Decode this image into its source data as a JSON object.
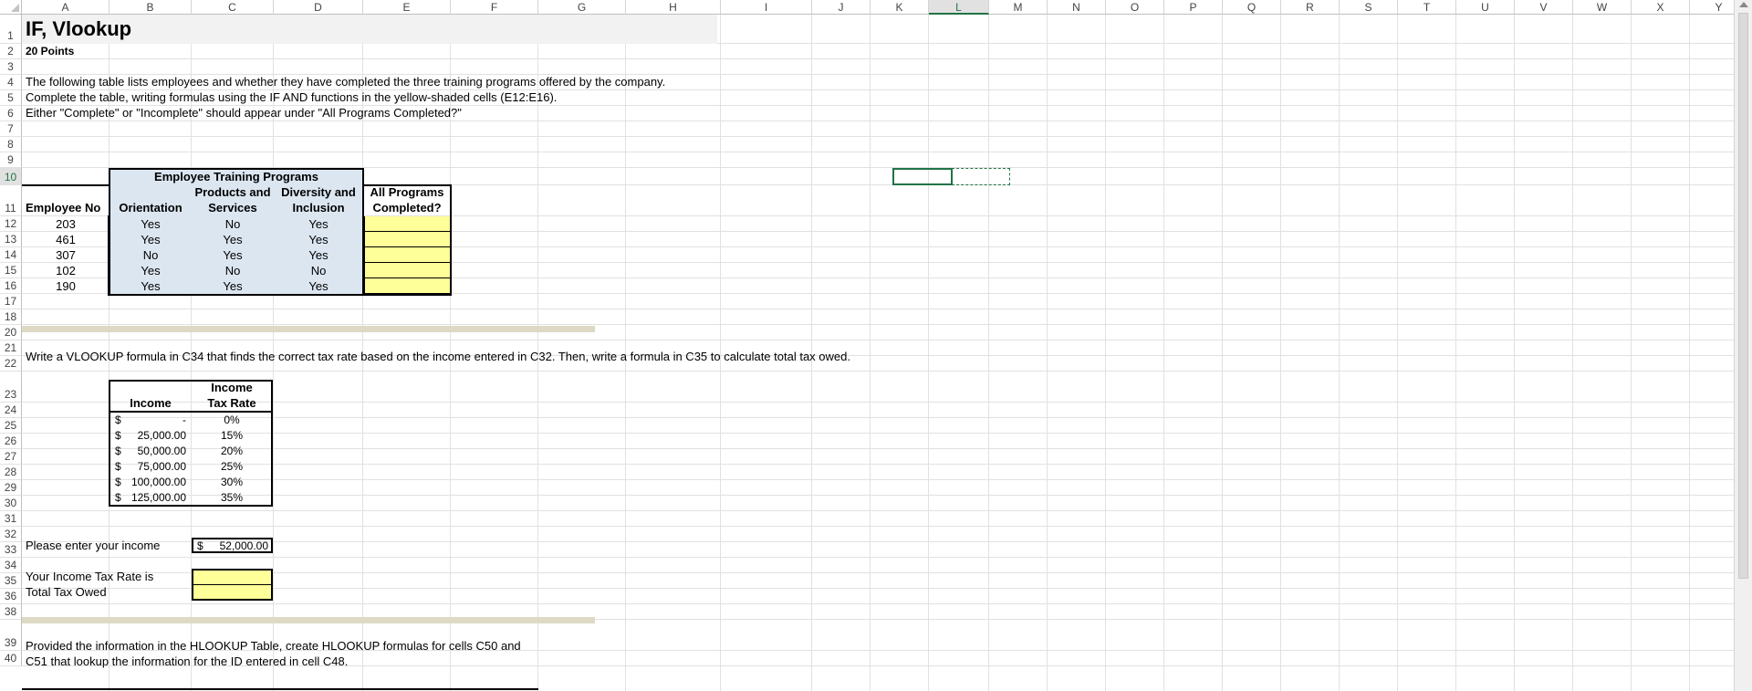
{
  "columns": [
    "A",
    "B",
    "C",
    "D",
    "E",
    "F",
    "G",
    "H",
    "I",
    "J",
    "K",
    "L",
    "M",
    "N",
    "O",
    "P",
    "Q",
    "R",
    "S",
    "T",
    "U",
    "V",
    "W",
    "X",
    "Y"
  ],
  "selected_column": "L",
  "rows": [
    {
      "n": "1"
    },
    {
      "n": "2"
    },
    {
      "n": "3"
    },
    {
      "n": "4"
    },
    {
      "n": "5"
    },
    {
      "n": "6"
    },
    {
      "n": "7"
    },
    {
      "n": "8"
    },
    {
      "n": "9"
    },
    {
      "n": "10"
    },
    {
      "n": "11"
    },
    {
      "n": "12"
    },
    {
      "n": "13"
    },
    {
      "n": "14"
    },
    {
      "n": "15"
    },
    {
      "n": "16"
    },
    {
      "n": "17"
    },
    {
      "n": "18"
    },
    {
      "n": "20"
    },
    {
      "n": "21"
    },
    {
      "n": "22"
    },
    {
      "n": "23"
    },
    {
      "n": "24"
    },
    {
      "n": "25"
    },
    {
      "n": "26"
    },
    {
      "n": "27"
    },
    {
      "n": "28"
    },
    {
      "n": "29"
    },
    {
      "n": "30"
    },
    {
      "n": "31"
    },
    {
      "n": "32"
    },
    {
      "n": "33"
    },
    {
      "n": "34"
    },
    {
      "n": "35"
    },
    {
      "n": "36"
    },
    {
      "n": "38"
    },
    {
      "n": "39"
    },
    {
      "n": "40"
    }
  ],
  "selected_row": "10",
  "title": "IF, Vlookup",
  "points": "20 Points",
  "instructions": [
    "The following table lists employees and whether they have completed the three training programs offered by the company.",
    "Complete the table, writing formulas using the IF AND functions in the yellow-shaded cells (E12:E16).",
    "Either \"Complete\" or \"Incomplete\" should appear under \"All Programs Completed?\""
  ],
  "training_table": {
    "group_header": "Employee Training Programs",
    "headers": {
      "employee_no": "Employee No",
      "orientation": "Orientation",
      "products_line1": "Products and",
      "products_line2": "Services",
      "diversity_line1": "Diversity and",
      "diversity_line2": "Inclusion",
      "all_line1": "All Programs",
      "all_line2": "Completed?"
    },
    "rows": [
      {
        "emp": "203",
        "orientation": "Yes",
        "products": "No",
        "diversity": "Yes"
      },
      {
        "emp": "461",
        "orientation": "Yes",
        "products": "Yes",
        "diversity": "Yes"
      },
      {
        "emp": "307",
        "orientation": "No",
        "products": "Yes",
        "diversity": "Yes"
      },
      {
        "emp": "102",
        "orientation": "Yes",
        "products": "No",
        "diversity": "No"
      },
      {
        "emp": "190",
        "orientation": "Yes",
        "products": "Yes",
        "diversity": "Yes"
      }
    ]
  },
  "vlookup_instruction": "Write a VLOOKUP formula in C34 that finds the correct tax rate based on the income entered in C32. Then, write a formula in C35 to calculate total tax owed.",
  "tax_table": {
    "income_header": "Income",
    "rate_header_line1": "Income",
    "rate_header_line2": "Tax Rate",
    "rows": [
      {
        "cur": "$",
        "amount": "-",
        "rate": "0%"
      },
      {
        "cur": "$",
        "amount": "25,000.00",
        "rate": "15%"
      },
      {
        "cur": "$",
        "amount": "50,000.00",
        "rate": "20%"
      },
      {
        "cur": "$",
        "amount": "75,000.00",
        "rate": "25%"
      },
      {
        "cur": "$",
        "amount": "100,000.00",
        "rate": "30%"
      },
      {
        "cur": "$",
        "amount": "125,000.00",
        "rate": "35%"
      }
    ]
  },
  "income_prompt": "Please enter your income",
  "income_value_cur": "$",
  "income_value": "52,000.00",
  "tax_rate_label": "Your Income Tax Rate is",
  "total_tax_label": "Total Tax Owed",
  "hlookup_instruction_line1": "Provided the information in the HLOOKUP Table, create HLOOKUP formulas for cells C50 and",
  "hlookup_instruction_line2": "C51 that lookup the information for the ID entered in cell C48.",
  "colors": {
    "blue_fill": "#dce6f1",
    "yellow_fill": "#ffff99",
    "band_fill": "#ddd9c4",
    "excel_green": "#217346"
  }
}
